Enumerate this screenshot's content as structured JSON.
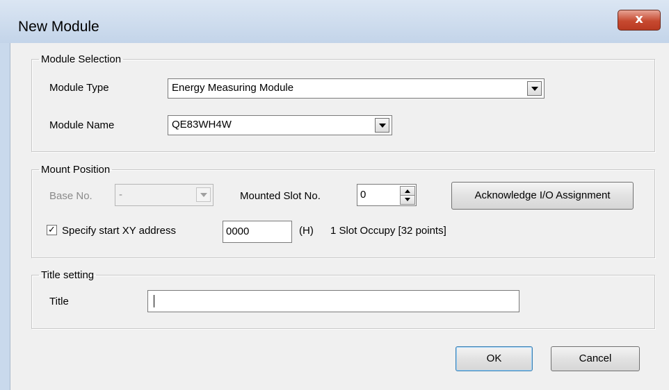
{
  "window": {
    "title": "New Module",
    "close_glyph": "x"
  },
  "module_selection": {
    "legend": "Module Selection",
    "module_type_label": "Module Type",
    "module_type_value": "Energy Measuring Module",
    "module_name_label": "Module Name",
    "module_name_value": "QE83WH4W"
  },
  "mount_position": {
    "legend": "Mount Position",
    "base_no_label": "Base No.",
    "base_no_value": "-",
    "mounted_slot_label": "Mounted Slot No.",
    "mounted_slot_value": "0",
    "acknowledge_button": "Acknowledge I/O Assignment",
    "specify_start_checked": true,
    "specify_start_label": "Specify start XY address",
    "start_xy_value": "0000",
    "hex_suffix": "(H)",
    "slot_occupy_text": "1 Slot Occupy [32 points]"
  },
  "title_setting": {
    "legend": "Title setting",
    "title_label": "Title",
    "title_value": ""
  },
  "buttons": {
    "ok": "OK",
    "cancel": "Cancel"
  },
  "icons": {
    "close": "close-icon",
    "dropdown": "chevron-down-icon",
    "spin_up": "chevron-up-icon",
    "spin_down": "chevron-down-icon",
    "check": "check-icon"
  },
  "colors": {
    "title_bar": "#c9d9ec",
    "close_button": "#c6492f",
    "client_bg": "#f0f0f0",
    "default_button_border": "#3c7fb1"
  }
}
